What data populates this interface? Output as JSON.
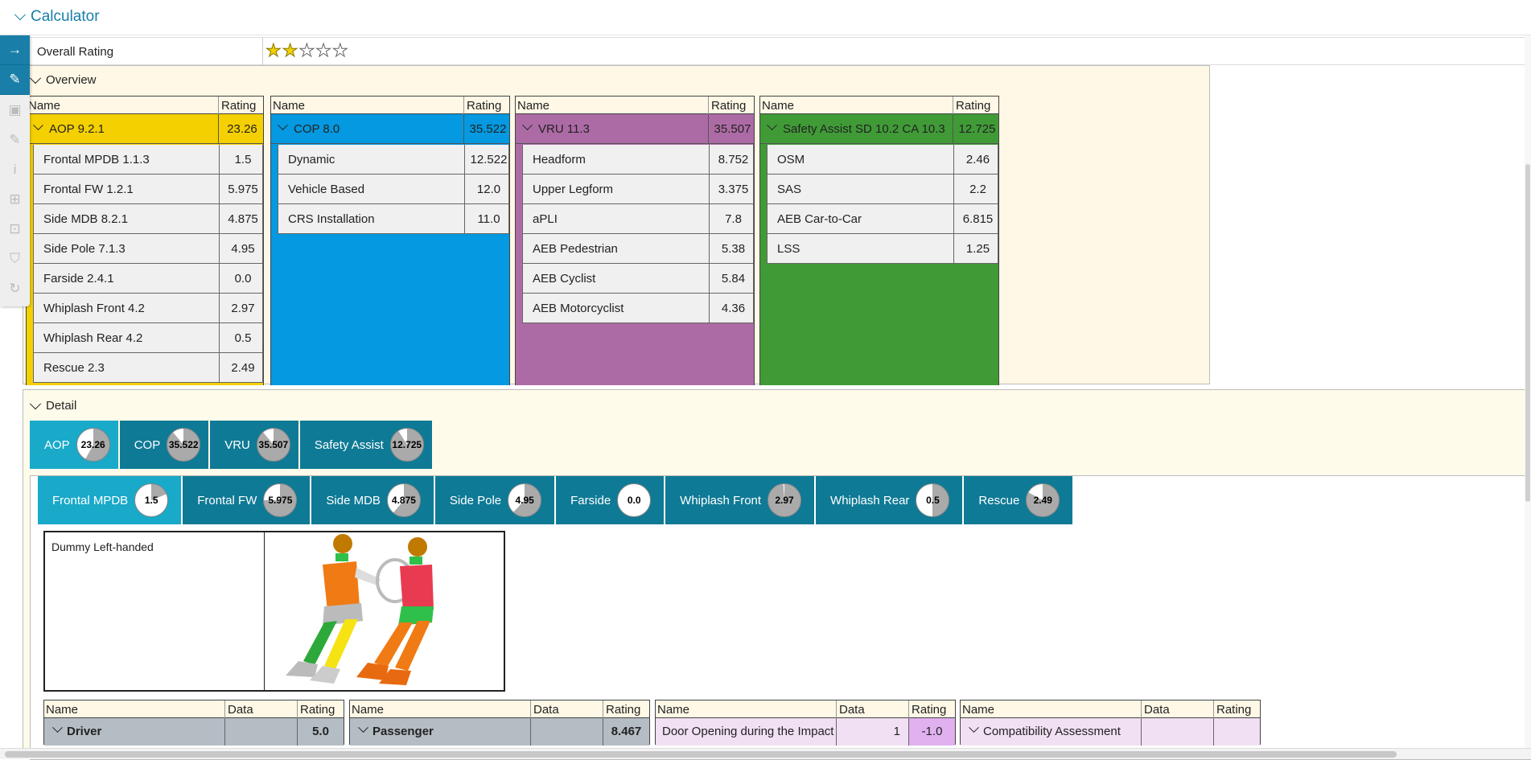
{
  "header": {
    "title": "Calculator"
  },
  "overall": {
    "label": "Overall Rating",
    "stars_filled": 2,
    "stars_total": 5
  },
  "toolbar": {
    "icons": [
      "arrow-right-icon",
      "pencil-icon",
      "save-icon",
      "edit-icon",
      "info-icon",
      "add-file-icon",
      "import-icon",
      "shield-icon",
      "refresh-icon"
    ]
  },
  "overview": {
    "label": "Overview",
    "col_name": "Name",
    "col_rating": "Rating",
    "groups": [
      {
        "name": "AOP 9.2.1",
        "rating": "23.26",
        "color": "#f5d000",
        "items": [
          {
            "name": "Frontal MPDB 1.1.3",
            "rating": "1.5"
          },
          {
            "name": "Frontal FW 1.2.1",
            "rating": "5.975"
          },
          {
            "name": "Side MDB 8.2.1",
            "rating": "4.875"
          },
          {
            "name": "Side Pole 7.1.3",
            "rating": "4.95"
          },
          {
            "name": "Farside 2.4.1",
            "rating": "0.0"
          },
          {
            "name": "Whiplash Front 4.2",
            "rating": "2.97"
          },
          {
            "name": "Whiplash Rear 4.2",
            "rating": "0.5"
          },
          {
            "name": "Rescue 2.3",
            "rating": "2.49"
          }
        ]
      },
      {
        "name": "COP 8.0",
        "rating": "35.522",
        "color": "#0499e0",
        "items": [
          {
            "name": "Dynamic",
            "rating": "12.522"
          },
          {
            "name": "Vehicle Based",
            "rating": "12.0"
          },
          {
            "name": "CRS Installation",
            "rating": "11.0"
          }
        ]
      },
      {
        "name": "VRU 11.3",
        "rating": "35.507",
        "color": "#ad6ba5",
        "items": [
          {
            "name": "Headform",
            "rating": "8.752"
          },
          {
            "name": "Upper Legform",
            "rating": "3.375"
          },
          {
            "name": "aPLI",
            "rating": "7.8"
          },
          {
            "name": "AEB Pedestrian",
            "rating": "5.38"
          },
          {
            "name": "AEB Cyclist",
            "rating": "5.84"
          },
          {
            "name": "AEB Motorcyclist",
            "rating": "4.36"
          }
        ]
      },
      {
        "name": "Safety Assist SD 10.2 CA 10.3",
        "rating": "12.725",
        "color": "#409b37",
        "items": [
          {
            "name": "OSM",
            "rating": "2.46"
          },
          {
            "name": "SAS",
            "rating": "2.2"
          },
          {
            "name": "AEB Car-to-Car",
            "rating": "6.815"
          },
          {
            "name": "LSS",
            "rating": "1.25"
          }
        ]
      }
    ]
  },
  "detail": {
    "label": "Detail",
    "tabs": [
      {
        "label": "AOP",
        "value": "23.26",
        "fraction": 0.58
      },
      {
        "label": "COP",
        "value": "35.522",
        "fraction": 0.89
      },
      {
        "label": "VRU",
        "value": "35.507",
        "fraction": 0.89
      },
      {
        "label": "Safety Assist",
        "value": "12.725",
        "fraction": 0.91
      }
    ],
    "subtabs": [
      {
        "label": "Frontal MPDB",
        "value": "1.5",
        "fraction": 0.19
      },
      {
        "label": "Frontal FW",
        "value": "5.975",
        "fraction": 0.75
      },
      {
        "label": "Side MDB",
        "value": "4.875",
        "fraction": 0.61
      },
      {
        "label": "Side Pole",
        "value": "4.95",
        "fraction": 0.62
      },
      {
        "label": "Farside",
        "value": "0.0",
        "fraction": 0
      },
      {
        "label": "Whiplash Front",
        "value": "2.97",
        "fraction": 0.99
      },
      {
        "label": "Whiplash Rear",
        "value": "0.5",
        "fraction": 0.5
      },
      {
        "label": "Rescue",
        "value": "2.49",
        "fraction": 0.83
      }
    ],
    "dummy_label": "Dummy Left-handed",
    "tables": [
      {
        "h_name": "Name",
        "h_data": "Data",
        "h_rating": "Rating",
        "name": "Driver",
        "data": "",
        "rating": "5.0"
      },
      {
        "h_name": "Name",
        "h_data": "Data",
        "h_rating": "Rating",
        "name": "Passenger",
        "data": "",
        "rating": "8.467"
      },
      {
        "h_name": "Name",
        "h_data": "Data",
        "h_rating": "Rating",
        "name": "Door Opening during the Impact",
        "data": "1",
        "rating": "-1.0"
      },
      {
        "h_name": "Name",
        "h_data": "Data",
        "h_rating": "Rating",
        "name": "Compatibility Assessment",
        "data": "",
        "rating": ""
      }
    ]
  }
}
